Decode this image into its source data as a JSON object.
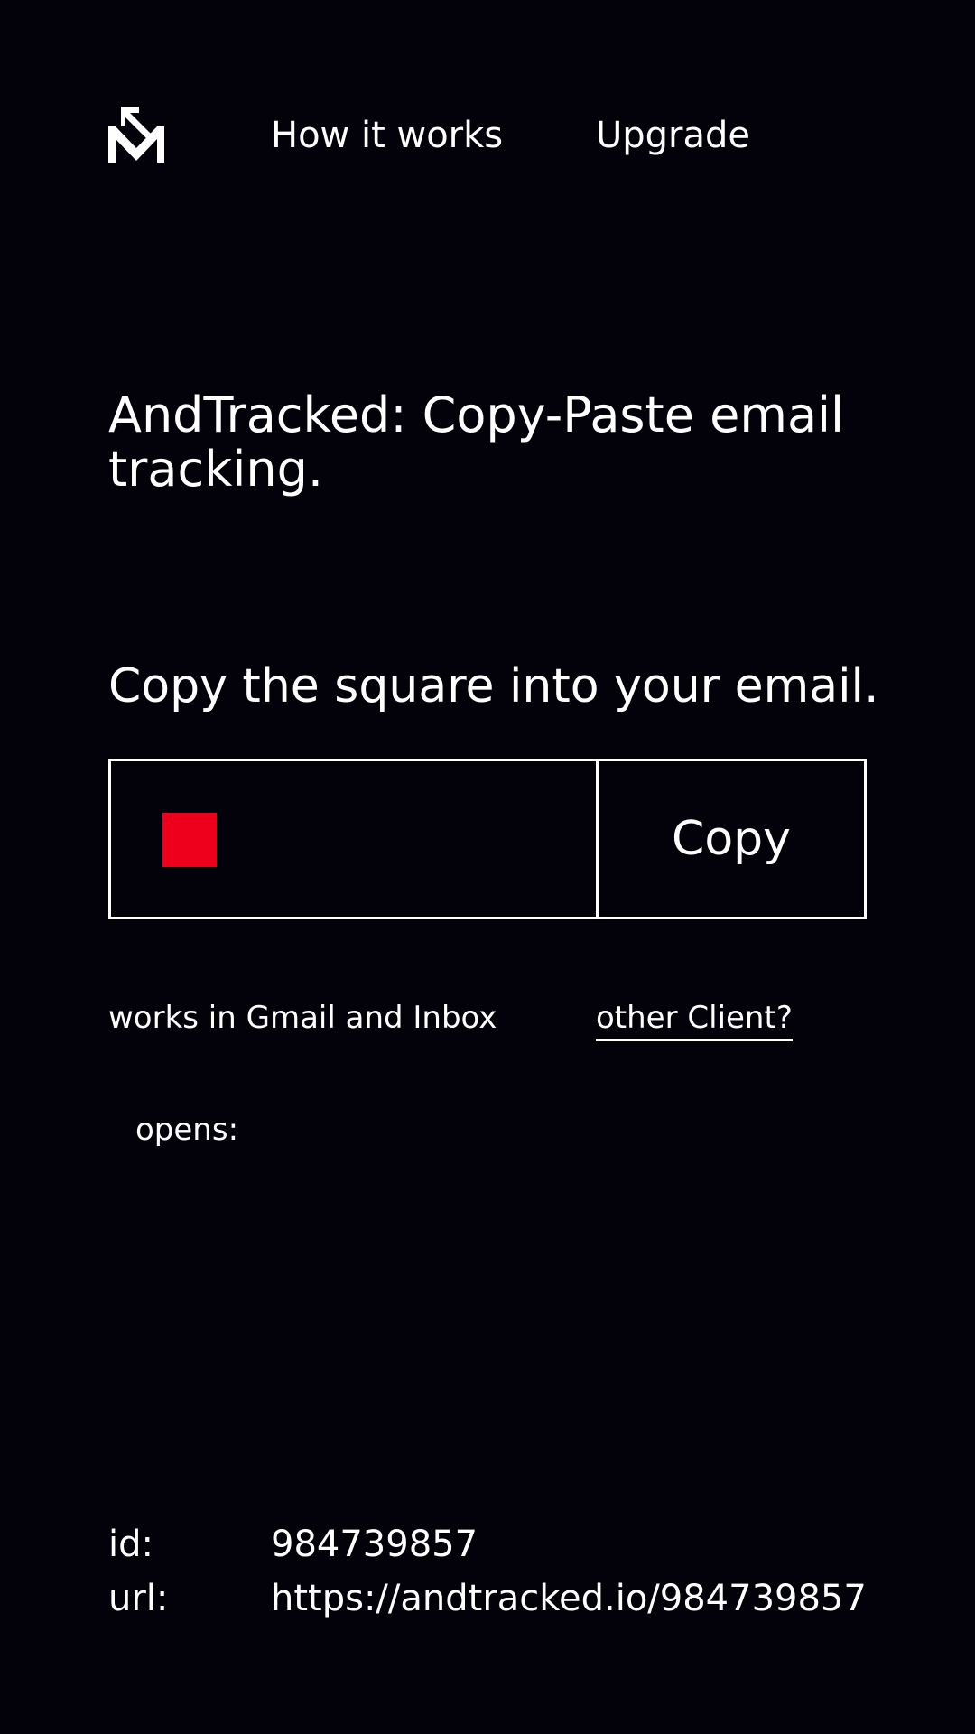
{
  "nav": {
    "logo_icon": "andtracked-logo-icon",
    "how_it_works": "How it works",
    "upgrade": "Upgrade"
  },
  "headline": "AndTracked: Copy-Paste email tracking.",
  "instruction": "Copy the square into your email.",
  "copy_box": {
    "square_color": "#ee001c",
    "copy_label": "Copy"
  },
  "compat": {
    "works_text": "works in Gmail and Inbox",
    "other_client_link": "other Client?"
  },
  "opens": {
    "label": "opens:"
  },
  "info": {
    "id_label": "id:",
    "id_value": "984739857",
    "url_label": "url:",
    "url_value": "https://andtracked.io/984739857"
  },
  "colors": {
    "background": "#03020a",
    "foreground": "#ffffff",
    "accent": "#ee001c"
  }
}
